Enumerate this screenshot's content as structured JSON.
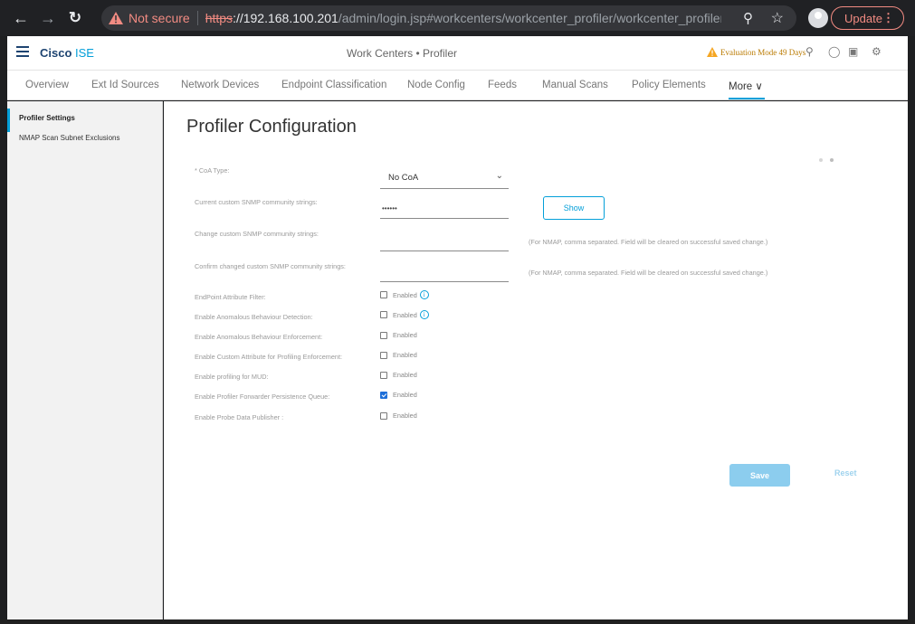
{
  "browser": {
    "not_secure_label": "Not secure",
    "url_scheme": "https",
    "url_host": "://192.168.100.201",
    "url_path": "/admin/login.jsp#workcenters/workcenter_profiler/workcenter_profiler_...",
    "update_label": "Update"
  },
  "header": {
    "brand_bold": "Cisco",
    "brand_rest": " ISE",
    "title": "Work Centers • Profiler",
    "evaluation": "Evaluation Mode 49 Days"
  },
  "tabs": [
    {
      "label": "Overview"
    },
    {
      "label": "Ext Id Sources"
    },
    {
      "label": "Network Devices"
    },
    {
      "label": "Endpoint Classification"
    },
    {
      "label": "Node Config"
    },
    {
      "label": "Feeds"
    },
    {
      "label": "Manual Scans"
    },
    {
      "label": "Policy Elements"
    },
    {
      "label": "More ∨"
    }
  ],
  "sidebar": {
    "items": [
      {
        "label": "Profiler Settings"
      },
      {
        "label": "NMAP Scan Subnet Exclusions"
      }
    ]
  },
  "main": {
    "title": "Profiler Configuration",
    "coa_label": "* CoA Type:",
    "coa_value": "No CoA",
    "current_snmp_label": "Current custom SNMP community strings:",
    "current_snmp_value": "••••••",
    "show_label": "Show",
    "change_snmp_label": "Change custom SNMP community strings:",
    "change_snmp_hint": "(For NMAP, comma separated. Field will be cleared on successful saved change.)",
    "confirm_snmp_label": "Confirm changed custom SNMP community strings:",
    "confirm_snmp_hint": "(For NMAP, comma separated. Field will be cleared on successful saved change.)",
    "checkboxes": [
      {
        "label": "EndPoint Attribute Filter:",
        "text": "Enabled",
        "checked": false,
        "info": true
      },
      {
        "label": "Enable Anomalous Behaviour Detection:",
        "text": "Enabled",
        "checked": false,
        "info": true
      },
      {
        "label": "Enable Anomalous Behaviour Enforcement:",
        "text": "Enabled",
        "checked": false,
        "info": false
      },
      {
        "label": "Enable Custom Attribute for Profiling Enforcement:",
        "text": "Enabled",
        "checked": false,
        "info": false
      },
      {
        "label": "Enable profiling for MUD:",
        "text": "Enabled",
        "checked": false,
        "info": false
      },
      {
        "label": "Enable Profiler Forwarder Persistence Queue:",
        "text": "Enabled",
        "checked": true,
        "info": false
      },
      {
        "label": "Enable Probe Data Publisher :",
        "text": "Enabled",
        "checked": false,
        "info": false
      }
    ],
    "save_label": "Save",
    "reset_label": "Reset"
  }
}
